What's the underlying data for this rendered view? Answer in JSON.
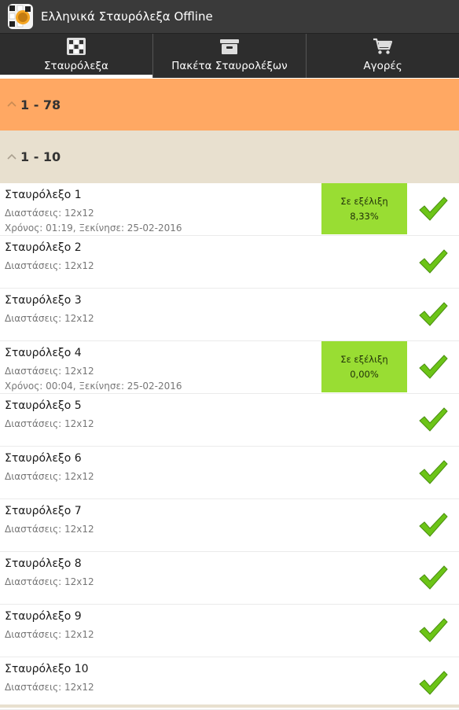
{
  "app": {
    "title": "Ελληνικά Σταυρόλεξα Offline",
    "icon": "crossword-logo-icon"
  },
  "tabs": [
    {
      "label": "Σταυρόλεξα",
      "icon": "crossword-grid-icon",
      "active": true
    },
    {
      "label": "Πακέτα Σταυρολέξων",
      "icon": "package-box-icon",
      "active": false
    },
    {
      "label": "Αγορές",
      "icon": "shopping-cart-icon",
      "active": false
    }
  ],
  "groups": {
    "outer": {
      "label": "1 - 78",
      "icon": "chevron-up-icon"
    },
    "inner": {
      "label": "1 - 10",
      "icon": "chevron-up-icon"
    }
  },
  "puzzles": [
    {
      "title": "Σταυρόλεξο 1",
      "dims": "Διαστάσεις: 12x12",
      "time": "Χρόνος: 01:19, Ξεκίνησε: 25-02-2016",
      "status": "Σε εξέλιξη",
      "progress": "8,33%"
    },
    {
      "title": "Σταυρόλεξο 2",
      "dims": "Διαστάσεις: 12x12"
    },
    {
      "title": "Σταυρόλεξο 3",
      "dims": "Διαστάσεις: 12x12"
    },
    {
      "title": "Σταυρόλεξο 4",
      "dims": "Διαστάσεις: 12x12",
      "time": "Χρόνος: 00:04, Ξεκίνησε: 25-02-2016",
      "status": "Σε εξέλιξη",
      "progress": "0,00%"
    },
    {
      "title": "Σταυρόλεξο 5",
      "dims": "Διαστάσεις: 12x12"
    },
    {
      "title": "Σταυρόλεξο 6",
      "dims": "Διαστάσεις: 12x12"
    },
    {
      "title": "Σταυρόλεξο 7",
      "dims": "Διαστάσεις: 12x12"
    },
    {
      "title": "Σταυρόλεξο 8",
      "dims": "Διαστάσεις: 12x12"
    },
    {
      "title": "Σταυρόλεξο 9",
      "dims": "Διαστάσεις: 12x12"
    },
    {
      "title": "Σταυρόλεξο 10",
      "dims": "Διαστάσεις: 12x12"
    }
  ],
  "colors": {
    "title_bar": "#3a3a3a",
    "tab_bar": "#2d2d2d",
    "outer_group": "#ffa863",
    "inner_group": "#e8e0cf",
    "progress_box": "#99dd33",
    "check_green": "#6cc417"
  }
}
